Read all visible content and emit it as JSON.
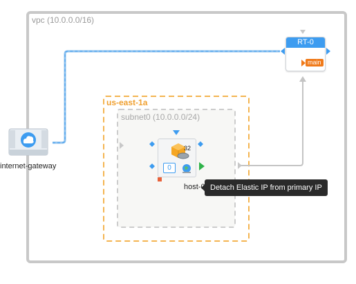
{
  "vpc": {
    "label": "vpc (10.0.0.0/16)"
  },
  "availability_zone": {
    "label": "us-east-1a"
  },
  "subnet": {
    "label": "subnet0 (10.0.0.0/24)"
  },
  "route_table": {
    "title": "RT-0",
    "badge": "main"
  },
  "internet_gateway": {
    "label": "internet-gateway"
  },
  "instance": {
    "label": "host-0",
    "count": "32",
    "volume_count": "0"
  },
  "tooltip": {
    "text": "Detach Elastic IP from primary IP"
  },
  "colors": {
    "accent_blue": "#3d9cf0",
    "zone_orange": "#f0a030",
    "main_orange": "#f07a1a",
    "port_green": "#2fb34a"
  },
  "icons": [
    "cloud-icon",
    "cube-icon",
    "disk-icon",
    "globe-icon",
    "arrow-right-icon",
    "arrow-down-icon",
    "diamond-port-icon"
  ]
}
